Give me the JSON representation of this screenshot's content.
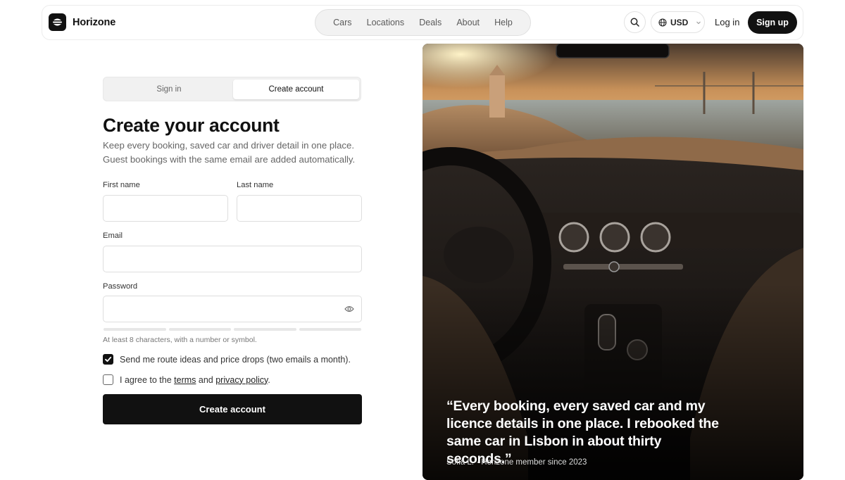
{
  "brand": {
    "name": "Horizone"
  },
  "nav": {
    "items": [
      "Cars",
      "Locations",
      "Deals",
      "About",
      "Help"
    ]
  },
  "header": {
    "search_icon": "search-icon",
    "currency": "USD",
    "login": "Log in",
    "signup": "Sign up"
  },
  "tabs": {
    "signin": "Sign in",
    "create": "Create account",
    "active": "create"
  },
  "form": {
    "title": "Create your account",
    "subtitle_line1": "Keep every booking, saved car and driver detail in one place.",
    "subtitle_line2": "Guest bookings with the same email are added automatically.",
    "first_name": {
      "label": "First name",
      "value": ""
    },
    "last_name": {
      "label": "Last name",
      "value": ""
    },
    "email": {
      "label": "Email",
      "value": ""
    },
    "password": {
      "label": "Password",
      "value": ""
    },
    "password_strength": 0,
    "hint": "At least 8 characters, with a number or symbol.",
    "newsletter": {
      "label": "Send me route ideas and price drops (two emails a month).",
      "checked": true
    },
    "terms": {
      "prefix": "I agree to the",
      "terms_link": "terms",
      "and": "and",
      "privacy_link": "privacy policy",
      "suffix": ".",
      "checked": false
    },
    "submit": "Create account"
  },
  "testimonial": {
    "quote": "“Every booking, every saved car and my licence details in one place. I rebooked the same car in Lisbon in about thirty seconds.”",
    "author": "Sofia L. · Horizone member since 2023"
  }
}
